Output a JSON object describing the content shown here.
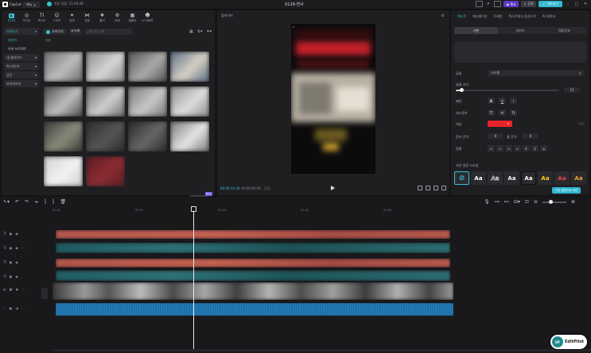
{
  "app": {
    "name": "CapCut",
    "menu_label": "메뉴",
    "autosave": "자동 저장: 15:49:49",
    "document_title": "0129-연사",
    "pro_label": "Pro",
    "share_label": "공유",
    "export_label": "내보내기"
  },
  "left_toolbar": [
    {
      "label": "미디어",
      "icon": "media-icon"
    },
    {
      "label": "오디오",
      "icon": "audio-icon"
    },
    {
      "label": "텍스트",
      "icon": "text-icon"
    },
    {
      "label": "스티커",
      "icon": "sticker-icon"
    },
    {
      "label": "효과",
      "icon": "effects-icon"
    },
    {
      "label": "전환",
      "icon": "transition-icon"
    },
    {
      "label": "필터",
      "icon": "filter-icon"
    },
    {
      "label": "조정",
      "icon": "adjust-icon"
    },
    {
      "label": "템플릿",
      "icon": "template-icon"
    },
    {
      "label": "AI 아바타",
      "icon": "avatar-icon"
    }
  ],
  "media_sidebar": [
    {
      "label": "가져오기",
      "style": "box-sel"
    },
    {
      "label": "미디어",
      "style": "sub-sel"
    },
    {
      "label": "하위 프로젝트",
      "style": "sub"
    },
    {
      "label": "내 클라우드",
      "style": "box"
    },
    {
      "label": "AI 미디어",
      "style": "box"
    },
    {
      "label": "공간",
      "style": "box"
    },
    {
      "label": "라이브러리",
      "style": "box"
    }
  ],
  "media_top": {
    "import_label": "가져오기",
    "record_label": "녹화",
    "search_placeholder": "미디어 검색",
    "all_label": "전체"
  },
  "media_thumbs": [
    {
      "c1": "#6d6d6d",
      "c2": "#bdbdbd"
    },
    {
      "c1": "#8a8a8a",
      "c2": "#d6d6d6"
    },
    {
      "c1": "#545454",
      "c2": "#aaaaaa"
    },
    {
      "c1": "#5b6e86",
      "c2": "#d7d0c3"
    },
    {
      "c1": "#4c4c4c",
      "c2": "#bfbfbf"
    },
    {
      "c1": "#6b6b6b",
      "c2": "#cfcfcf"
    },
    {
      "c1": "#767676",
      "c2": "#c8c8c8"
    },
    {
      "c1": "#8d8d8d",
      "c2": "#dedede"
    },
    {
      "c1": "#3b3b3b",
      "c2": "#8a8a7a"
    },
    {
      "c1": "#2d2d2d",
      "c2": "#555555"
    },
    {
      "c1": "#2b2b2b",
      "c2": "#666666"
    },
    {
      "c1": "#7a7a7a",
      "c2": "#e5e5e5"
    },
    {
      "c1": "#cfcfcf",
      "c2": "#f3f3f3"
    },
    {
      "c1": "#5a1e22",
      "c2": "#8b2c33"
    }
  ],
  "ai_button": "AI 생성",
  "new_badge": "New",
  "player": {
    "title": "플레이어",
    "time_current": "00:00:14:20",
    "time_total": "00:00:49:09"
  },
  "right_tabs": [
    "텍스트",
    "애니메이션",
    "트래킹",
    "텍스트에서 음성으로",
    "AI 캐릭터"
  ],
  "right_subtabs": [
    "기본",
    "글머리",
    "템플릿표"
  ],
  "props": {
    "font_label": "글꼴",
    "font_value": "시스템",
    "size_label": "글꼴 크기",
    "size_value": "15",
    "size_level": 0.05,
    "pattern_label": "패턴",
    "case_label": "대소문자",
    "color_label": "색상",
    "char_spacing_label": "문자 간격",
    "char_spacing_value": "0",
    "line_spacing_label": "줄 간격",
    "line_spacing_value": "0",
    "align_label": "정렬",
    "preset_label": "사전 설정 스타일",
    "save_preset_label": "사전 설정으로 저장",
    "color_value": "#e8242b"
  },
  "presets": [
    {
      "label": "",
      "bg": "#2b2b2f",
      "fg": "#38c2d6"
    },
    {
      "label": "Aa",
      "bg": "#2b2b2f",
      "fg": "#ffffff"
    },
    {
      "label": "Aa",
      "bg": "#2b2b2f",
      "fg": "#111111"
    },
    {
      "label": "Aa",
      "bg": "#2b2b2f",
      "fg": "#ffffff"
    },
    {
      "label": "Aa",
      "bg": "#2b2b2f",
      "fg": "#ffffff"
    },
    {
      "label": "Aa",
      "bg": "#2b2b2f",
      "fg": "#f2d21a"
    },
    {
      "label": "Aa",
      "bg": "#2b2b2f",
      "fg": "#e34a4a"
    },
    {
      "label": "Aa",
      "bg": "#2b2b2f",
      "fg": "#f0a23a"
    }
  ],
  "ruler_ticks": [
    "00:00",
    "00:10",
    "00:20",
    "00:30",
    "00:40"
  ],
  "watermark_text": "EditPilot",
  "watermark_logo": "EP"
}
